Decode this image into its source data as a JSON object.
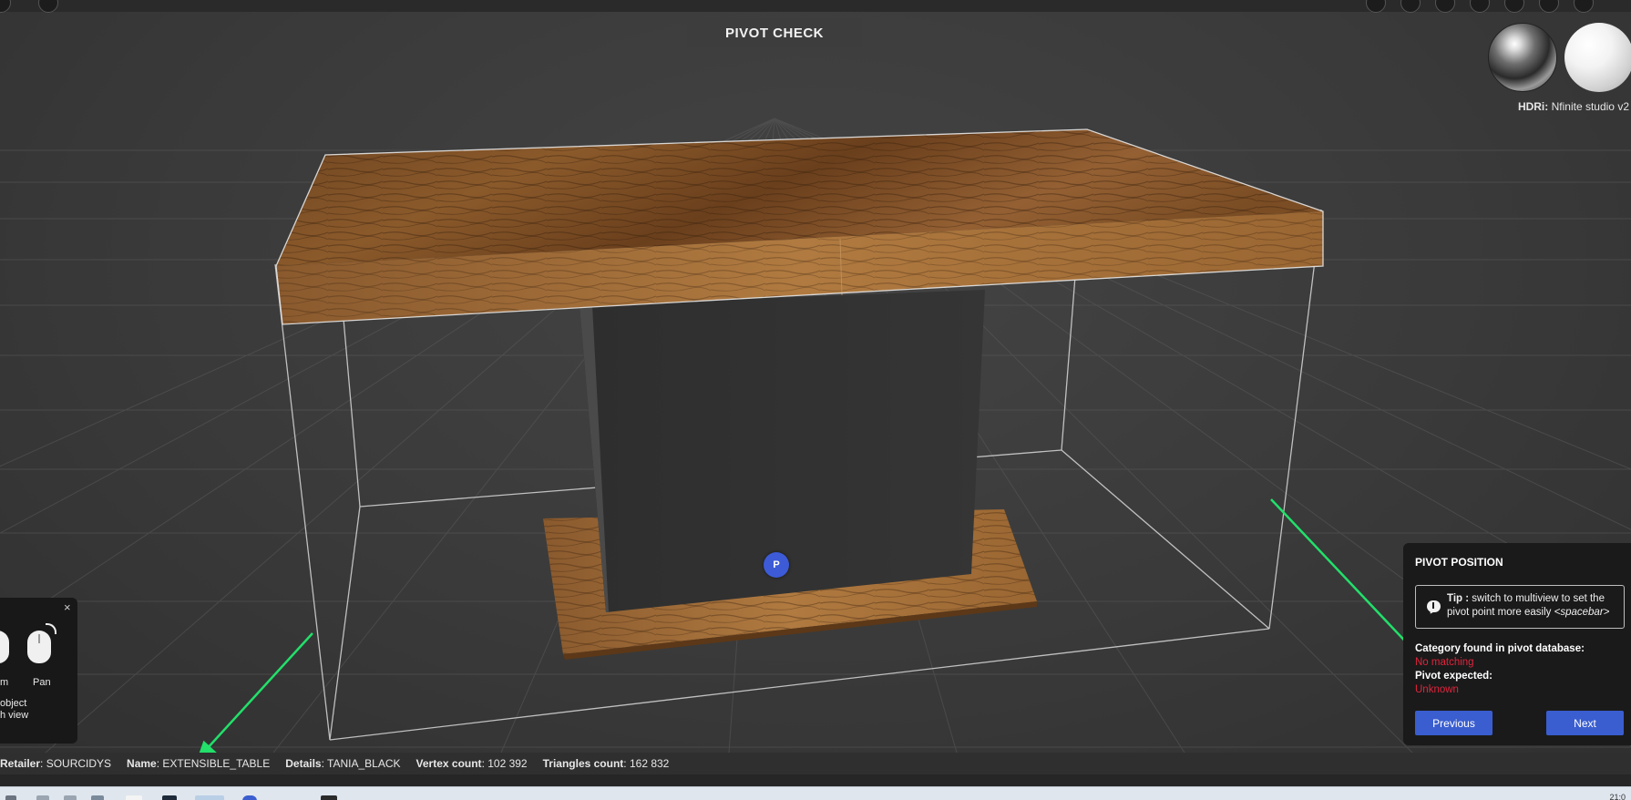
{
  "viewer": {
    "title": "PIVOT CHECK",
    "hdri_label": "HDRi:",
    "hdri_value": "Nfinite studio v2",
    "pivot_marker": "P"
  },
  "controls": {
    "close": "×",
    "zoom_label_partial": "m",
    "pan_label": "Pan",
    "hint_line1": "object",
    "hint_line2": "h view"
  },
  "pivot_panel": {
    "title": "PIVOT POSITION",
    "tip_label": "Tip :",
    "tip_text": " switch to multiview to set the pivot point more easily ",
    "tip_key": "<spacebar>",
    "category_label": "Category found in pivot database:",
    "category_value": "No matching",
    "pivot_label": "Pivot expected:",
    "pivot_value": "Unknown",
    "previous_label": "Previous",
    "next_label": "Next"
  },
  "info_bar": {
    "retailer_label": "Retailer",
    "retailer_value": ": SOURCIDYS",
    "name_label": "Name",
    "name_value": ": EXTENSIBLE_TABLE",
    "details_label": "Details",
    "details_value": ": TANIA_BLACK",
    "vertex_label": "Vertex count",
    "vertex_value": ": 102 392",
    "triangles_label": "Triangles count",
    "triangles_value": ": 162 832"
  },
  "taskbar": {
    "clock": "21:0"
  },
  "colors": {
    "accent": "#3a5ecf",
    "error": "#e0243d",
    "annotation_arrow": "#22e06a",
    "wood": "#7a4a22"
  }
}
